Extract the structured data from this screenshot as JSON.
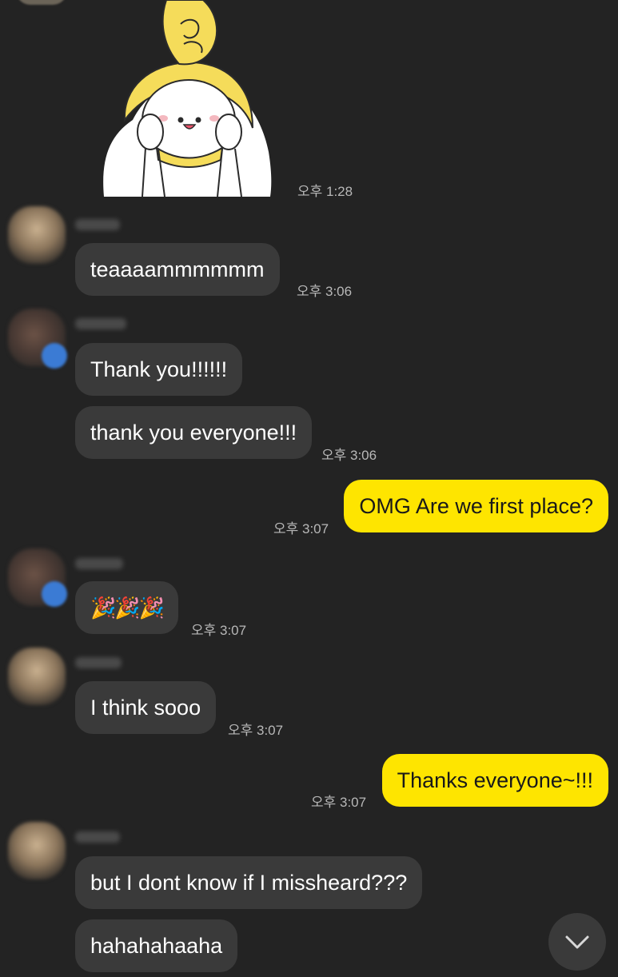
{
  "messages": [
    {
      "text": "teaaaammmmmm",
      "time": "오후 3:06"
    },
    {
      "text": "Thank you!!!!!!"
    },
    {
      "text": "thank you everyone!!!",
      "time": "오후 3:06"
    },
    {
      "text": "OMG Are we first place?",
      "time": "오후 3:07"
    },
    {
      "text": "🎉🎉🎉",
      "time": "오후 3:07"
    },
    {
      "text": "I think sooo",
      "time": "오후 3:07"
    },
    {
      "text": "Thanks everyone~!!!",
      "time": "오후 3:07"
    },
    {
      "text": "but I dont know if I missheard???"
    },
    {
      "text": "hahahahaaha"
    }
  ],
  "sticker": {
    "time": "오후 1:28",
    "icon": "cheering-character-sticker"
  },
  "controls": {
    "scroll_down_icon": "chevron-down-icon"
  },
  "colors": {
    "background": "#232323",
    "incoming_bubble": "#3a3a3a",
    "outgoing_bubble": "#fee500"
  }
}
